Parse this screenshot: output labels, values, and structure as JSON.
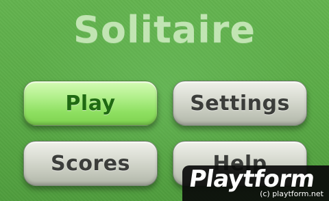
{
  "game": {
    "title": "Solitaire"
  },
  "menu": {
    "play_label": "Play",
    "settings_label": "Settings",
    "scores_label": "Scores",
    "help_label": "Help"
  },
  "watermark": {
    "logo_text": "Playtform",
    "url": "(c) playtform.net"
  },
  "colors": {
    "felt_green": "#5aab47",
    "play_button": "#b3f08d",
    "play_text": "#1f6a12",
    "gray_button": "#d8dbd1",
    "gray_text": "#3b3d3a"
  }
}
